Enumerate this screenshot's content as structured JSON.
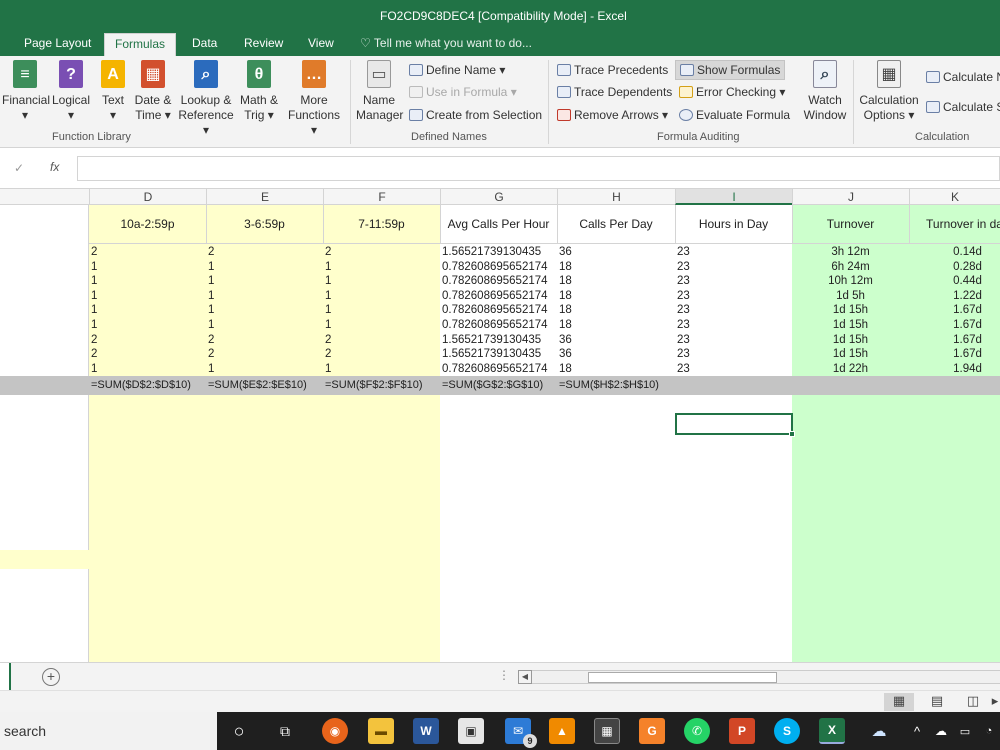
{
  "window": {
    "title": "FO2CD9C8DEC4  [Compatibility Mode]  -  Excel"
  },
  "ribbon_tabs": [
    "Page Layout",
    "Formulas",
    "Data",
    "Review",
    "View"
  ],
  "tell_me": "Tell me what you want to do...",
  "ribbon": {
    "function_library": {
      "label": "Function Library",
      "buttons": [
        {
          "l1": "Financial",
          "l2": "",
          "color": "#3d8e5b",
          "glyph": "≡"
        },
        {
          "l1": "Logical",
          "l2": "",
          "color": "#7a4fb3",
          "glyph": "?"
        },
        {
          "l1": "Text",
          "l2": "",
          "color": "#f5b400",
          "glyph": "A"
        },
        {
          "l1": "Date &",
          "l2": "Time",
          "color": "#d2502e",
          "glyph": "▦"
        },
        {
          "l1": "Lookup &",
          "l2": "Reference",
          "color": "#2b6bbd",
          "glyph": "⌕"
        },
        {
          "l1": "Math &",
          "l2": "Trig",
          "color": "#3d8e5b",
          "glyph": "θ"
        },
        {
          "l1": "More",
          "l2": "Functions",
          "color": "#e07b2a",
          "glyph": "…"
        }
      ]
    },
    "defined_names": {
      "label": "Defined Names",
      "name_manager_l1": "Name",
      "name_manager_l2": "Manager",
      "define_name": "Define Name",
      "use_in_formula": "Use in Formula",
      "create_from_selection": "Create from Selection"
    },
    "formula_auditing": {
      "label": "Formula Auditing",
      "trace_precedents": "Trace Precedents",
      "trace_dependents": "Trace Dependents",
      "remove_arrows": "Remove Arrows",
      "show_formulas": "Show Formulas",
      "error_checking": "Error Checking",
      "evaluate_formula": "Evaluate Formula",
      "watch_window_l1": "Watch",
      "watch_window_l2": "Window"
    },
    "calculation": {
      "label": "Calculation",
      "options_l1": "Calculation",
      "options_l2": "Options",
      "calc_now": "Calculate N",
      "calc_sheet": "Calculate S"
    }
  },
  "formula_bar": {
    "fx": "fx",
    "value": ""
  },
  "columns": [
    "D",
    "E",
    "F",
    "G",
    "H",
    "I",
    "J",
    "K"
  ],
  "headers": [
    "10a-2:59p",
    "3-6:59p",
    "7-11:59p",
    "Avg Calls Per Hour",
    "Calls Per Day",
    "Hours in Day",
    "Turnover",
    "Turnover in day"
  ],
  "rows": [
    [
      "2",
      "2",
      "2",
      "1.56521739130435",
      "36",
      "23",
      "3h 12m",
      "0.14d"
    ],
    [
      "1",
      "1",
      "1",
      "0.782608695652174",
      "18",
      "23",
      "6h 24m",
      "0.28d"
    ],
    [
      "1",
      "1",
      "1",
      "0.782608695652174",
      "18",
      "23",
      "10h 12m",
      "0.44d"
    ],
    [
      "1",
      "1",
      "1",
      "0.782608695652174",
      "18",
      "23",
      "1d 5h",
      "1.22d"
    ],
    [
      "1",
      "1",
      "1",
      "0.782608695652174",
      "18",
      "23",
      "1d 15h",
      "1.67d"
    ],
    [
      "1",
      "1",
      "1",
      "0.782608695652174",
      "18",
      "23",
      "1d 15h",
      "1.67d"
    ],
    [
      "2",
      "2",
      "2",
      "1.56521739130435",
      "36",
      "23",
      "1d 15h",
      "1.67d"
    ],
    [
      "2",
      "2",
      "2",
      "1.56521739130435",
      "36",
      "23",
      "1d 15h",
      "1.67d"
    ],
    [
      "1",
      "1",
      "1",
      "0.782608695652174",
      "18",
      "23",
      "1d 22h",
      "1.94d"
    ]
  ],
  "totals": [
    "=SUM($D$2:$D$10)",
    "=SUM($E$2:$E$10)",
    "=SUM($F$2:$F$10)",
    "=SUM($G$2:$G$10)",
    "=SUM($H$2:$H$10)"
  ],
  "colors": {
    "excel_green": "#217346",
    "yellow_fill": "#ffffcc",
    "green_fill": "#ccffcc",
    "total_row": "#c4c4c4"
  },
  "taskbar": {
    "search": "search",
    "mail_badge": "9"
  }
}
